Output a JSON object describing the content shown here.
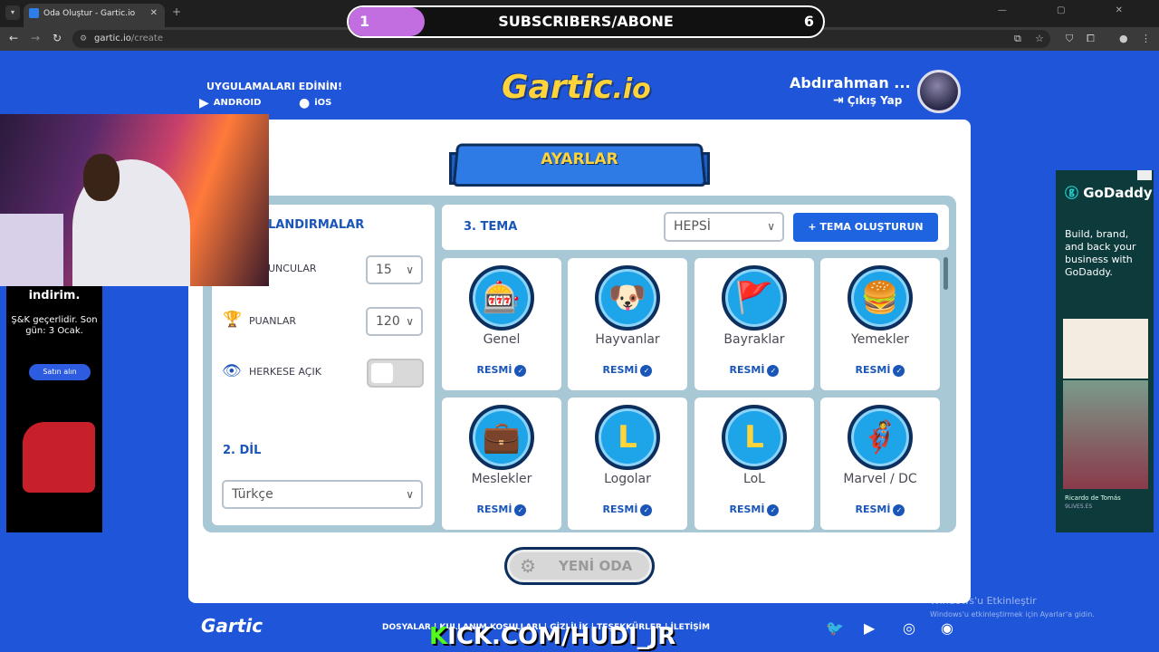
{
  "browser": {
    "tab_title": "Oda Oluştur - Gartic.io",
    "url_host": "gartic.io",
    "url_path": "/create"
  },
  "overlay": {
    "subs_current": "1",
    "subs_label": "SUBSCRIBERS/ABONE",
    "subs_goal": "6",
    "subs_progress": 0.16,
    "kick_k": "K",
    "kick_rest": "ICK.COM/HUDI_JR",
    "windows_activate_title": "Windows'u Etkinleştir",
    "windows_activate_sub": "Windows'u etkinleştirmek için Ayarlar'a gidin."
  },
  "header": {
    "promo_title": "UYGULAMALARI EDİNİN!",
    "android": "ANDROID",
    "ios": "iOS",
    "logo_main": "Gartic",
    "logo_io": ".io",
    "user_name": "Abdırahman ...",
    "logout": "Çıkış Yap"
  },
  "settings": {
    "banner": "AYARLAR",
    "section1_title": "LANDIRMALAR",
    "players_label": "UNCULAR",
    "players_value": "15",
    "points_label": "PUANLAR",
    "points_value": "120",
    "public_label": "HERKESE AÇIK",
    "section2_title": "2. DİL",
    "language_value": "Türkçe",
    "section3_title": "3. TEMA",
    "theme_filter": "HEPSİ",
    "create_theme": "TEMA OLUŞTURUN",
    "new_room": "YENİ ODA"
  },
  "themes": [
    {
      "name": "Genel",
      "badge": "RESMİ",
      "icon": "slot-machine-icon",
      "glyph": "🎰"
    },
    {
      "name": "Hayvanlar",
      "badge": "RESMİ",
      "icon": "dog-icon",
      "glyph": "🐶"
    },
    {
      "name": "Bayraklar",
      "badge": "RESMİ",
      "icon": "flag-icon",
      "glyph": "🚩"
    },
    {
      "name": "Yemekler",
      "badge": "RESMİ",
      "icon": "burger-icon",
      "glyph": "🍔"
    },
    {
      "name": "Meslekler",
      "badge": "RESMİ",
      "icon": "briefcase-icon",
      "glyph": "💼"
    },
    {
      "name": "Logolar",
      "badge": "RESMİ",
      "icon": "logo-icon",
      "glyph": "L"
    },
    {
      "name": "LoL",
      "badge": "RESMİ",
      "icon": "lol-icon",
      "glyph": "L"
    },
    {
      "name": "Marvel / DC",
      "badge": "RESMİ",
      "icon": "hero-mask-icon",
      "glyph": "🦸"
    }
  ],
  "footer": {
    "logo": "Gartic",
    "links": "DOSYALAR  |  KULLANIM KOŞULLARI  |  GİZLİLİK  |  TEŞEKKÜRLER  |  İLETİŞİM"
  },
  "ad_left": {
    "headline": "indirim.",
    "body": "Ş&K geçerlidir. Son gün: 3 Ocak.",
    "button": "Satın alın"
  },
  "ad_right": {
    "brand": "GoDaddy",
    "text": "Build, brand, and back your business with GoDaddy.",
    "credit": "Ricardo de Tomás",
    "credit_sub": "9LIVES.ES"
  }
}
